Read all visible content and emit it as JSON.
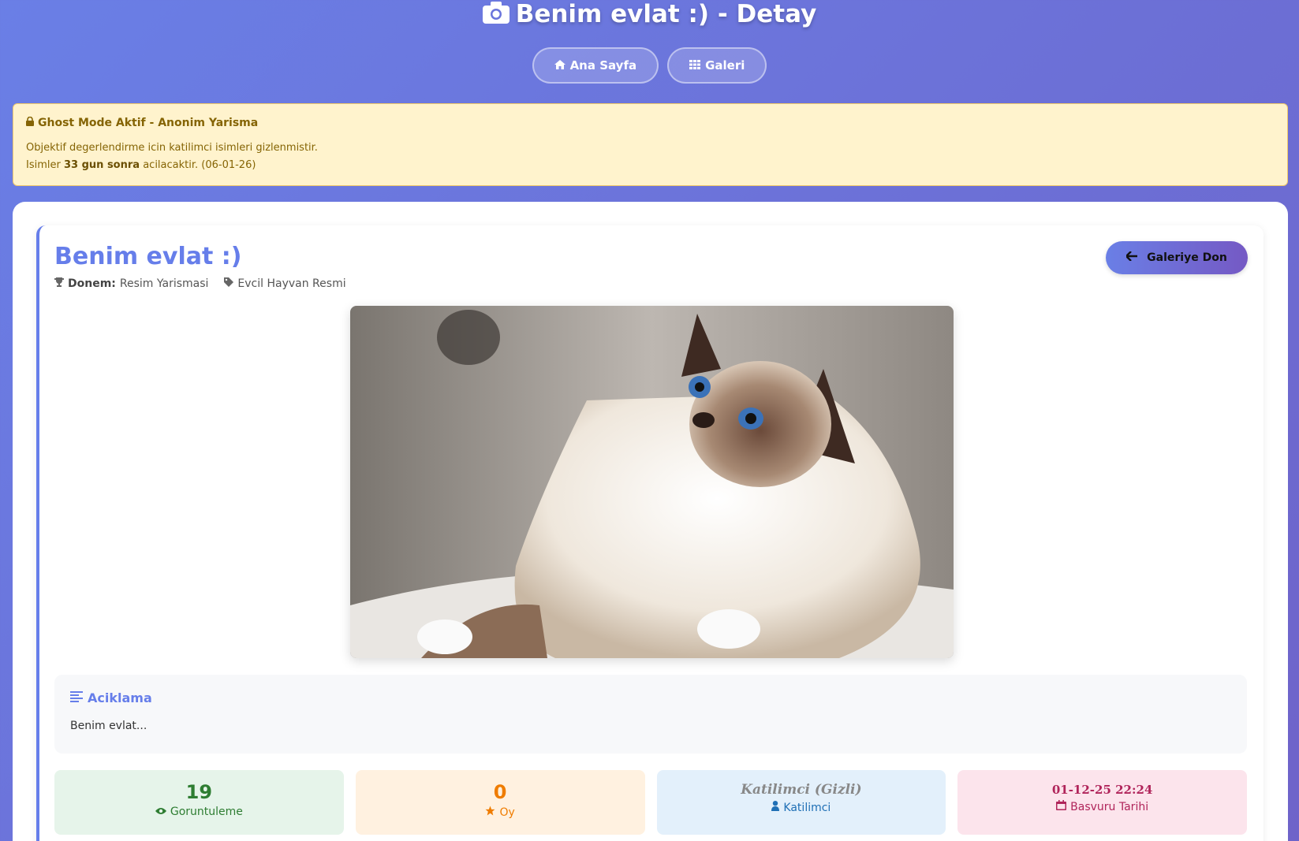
{
  "header": {
    "title": "Benim evlat :) - Detay",
    "nav": [
      {
        "label": "Ana Sayfa",
        "icon": "home-icon"
      },
      {
        "label": "Galeri",
        "icon": "grid-icon"
      }
    ]
  },
  "alert": {
    "title": "Ghost Mode Aktif - Anonim Yarisma",
    "line1": "Objektif degerlendirme icin katilimci isimleri gizlenmistir.",
    "line2_prefix": "Isimler",
    "line2_bold": "33 gun sonra",
    "line2_suffix": "acilacaktir. (06-01-26)"
  },
  "entry": {
    "title": "Benim evlat :)",
    "period_label": "Donem:",
    "period_value": "Resim Yarismasi",
    "category": "Evcil Hayvan Resmi",
    "back_button": "Galeriye Don"
  },
  "description": {
    "title": "Aciklama",
    "text": "Benim evlat..."
  },
  "stats": {
    "views": {
      "value": "19",
      "label": "Goruntuleme"
    },
    "votes": {
      "value": "0",
      "label": "Oy"
    },
    "participant": {
      "value": "Katilimci (Gizli)",
      "label": "Katilimci"
    },
    "date": {
      "value": "01-12-25 22:24",
      "label": "Basvuru Tarihi"
    }
  },
  "colors": {
    "accent": "#667eea",
    "alert_bg": "#fff3cd",
    "views": "#2e7d32",
    "votes": "#ef7c00",
    "participant": "#1f6fb5",
    "date": "#b0245a"
  }
}
